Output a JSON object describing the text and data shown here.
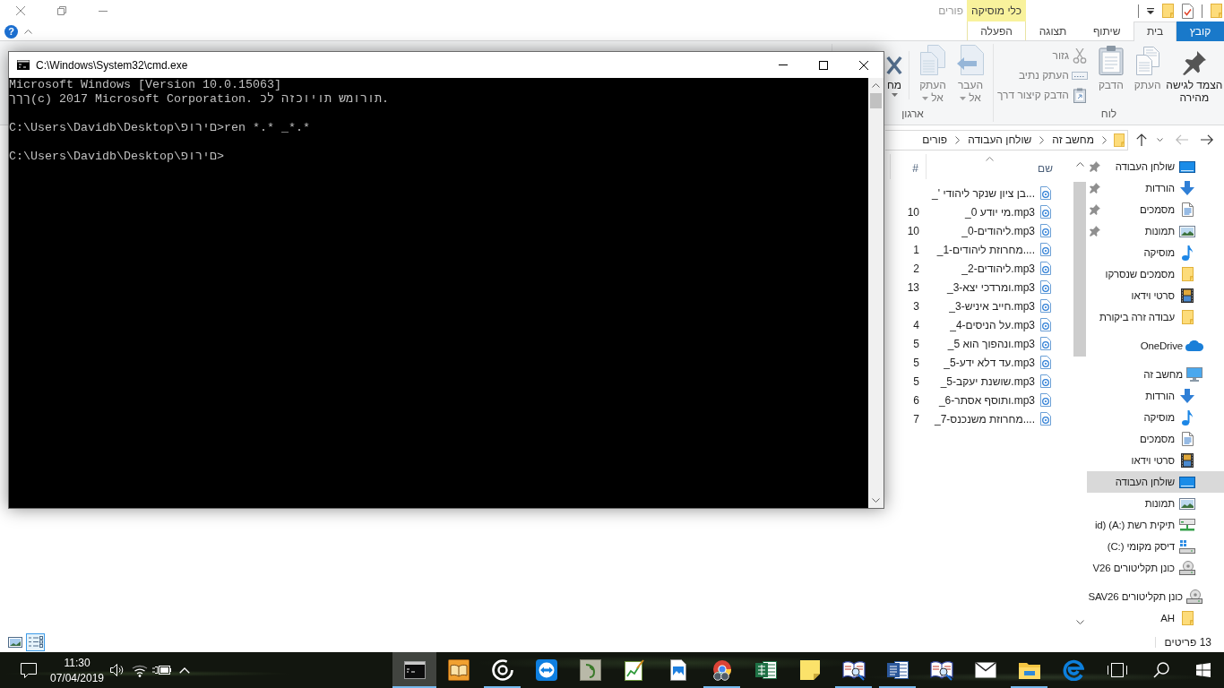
{
  "explorer": {
    "title": "פורים",
    "context_tab_group": "כלי מוסיקה",
    "help_button": "?",
    "ribbon_tabs": [
      {
        "label": "קובץ",
        "kind": "file",
        "selected": false
      },
      {
        "label": "בית",
        "kind": "tab",
        "selected": true
      },
      {
        "label": "שיתוף",
        "kind": "tab",
        "selected": false
      },
      {
        "label": "תצוגה",
        "kind": "tab",
        "selected": false
      },
      {
        "label": "הפעלה",
        "kind": "context",
        "selected": false
      }
    ],
    "ribbon_groups": [
      {
        "label": "לוח",
        "commands": [
          {
            "label": "הצמד לגישה מהירה",
            "kind": "pin",
            "disabled": false
          },
          {
            "label": "העתק",
            "kind": "copy",
            "disabled": true
          },
          {
            "label": "הדבק",
            "kind": "paste",
            "disabled": true
          },
          {
            "label": "גזור",
            "kind": "cut",
            "disabled": true
          },
          {
            "label": "העתק נתיב",
            "kind": "copypath",
            "disabled": true
          },
          {
            "label": "הדבק קיצור דרך",
            "kind": "pasteshortcut",
            "disabled": true
          }
        ]
      },
      {
        "label": "ארגון",
        "commands": [
          {
            "label": "העבר אל",
            "kind": "moveto",
            "disabled": true,
            "dropdown": true
          },
          {
            "label": "העתק אל",
            "kind": "copyto",
            "disabled": true,
            "dropdown": true
          },
          {
            "label": "מח",
            "kind": "delete",
            "disabled": false,
            "dropdown": true
          }
        ]
      }
    ],
    "address_bar": {
      "back": {
        "disabled": false
      },
      "forward": {
        "disabled": true
      },
      "path": [
        "מחשב זה",
        "שולחן העבודה",
        "פורים"
      ]
    },
    "file_list": {
      "columns": [
        {
          "label": "שם",
          "sorted": true
        },
        {
          "label": "#",
          "sorted": false
        }
      ],
      "rows": [
        {
          "name": "_' בן ציון שנקר ליהודי..."
        },
        {
          "name": "_0 מי יודע.mp3",
          "track": "10"
        },
        {
          "name": "_0-ליהודים.mp3",
          "track": "10"
        },
        {
          "name": "_1-מחרוזת ליהודים....",
          "track": "1"
        },
        {
          "name": "_2-ליהודים.mp3",
          "track": "2"
        },
        {
          "name": "_3-ומרדכי יצא.mp3",
          "track": "13"
        },
        {
          "name": "_3-חייב איניש.mp3",
          "track": "3"
        },
        {
          "name": "_4-על הניסים.mp3",
          "track": "4"
        },
        {
          "name": "_5 ונהפוך הוא.mp3",
          "track": "5"
        },
        {
          "name": "_5-עד דלא ידע.mp3",
          "track": "5"
        },
        {
          "name": "_5-שושנת יעקב.mp3",
          "track": "5"
        },
        {
          "name": "_6-ותוסף אסתר.mp3",
          "track": "6"
        },
        {
          "name": "_7-מחרוזת משנכנס....",
          "track": "7"
        }
      ]
    },
    "navigation_pane": {
      "quick_access": [
        {
          "label": "שולחן העבודה",
          "kind": "desktop",
          "pinned": true,
          "selected": false
        },
        {
          "label": "הורדות",
          "kind": "downloads",
          "pinned": true,
          "selected": false
        },
        {
          "label": "מסמכים",
          "kind": "documents",
          "pinned": true,
          "selected": false
        },
        {
          "label": "תמונות",
          "kind": "pictures",
          "pinned": true,
          "selected": false
        },
        {
          "label": "מוסיקה",
          "kind": "music",
          "pinned": false,
          "selected": false
        },
        {
          "label": "מסמכים שנסרקו",
          "kind": "folder",
          "pinned": false,
          "selected": false
        },
        {
          "label": "סרטי וידאו",
          "kind": "videos",
          "pinned": false,
          "selected": false
        },
        {
          "label": "עבודה זרה ביקורת",
          "kind": "folder",
          "pinned": false,
          "selected": false
        }
      ],
      "tree": [
        {
          "label": "OneDrive",
          "kind": "cloud",
          "selected": false
        },
        {
          "label": "מחשב זה",
          "kind": "computer",
          "selected": false,
          "children": [
            {
              "label": "הורדות",
              "kind": "downloads",
              "selected": false
            },
            {
              "label": "מוסיקה",
              "kind": "music",
              "selected": false
            },
            {
              "label": "מסמכים",
              "kind": "documents",
              "selected": false
            },
            {
              "label": "סרטי וידאו",
              "kind": "videos",
              "selected": false
            },
            {
              "label": "שולחן העבודה",
              "kind": "desktop",
              "selected": true
            },
            {
              "label": "תמונות",
              "kind": "pictures",
              "selected": false
            },
            {
              "label": "id) (A:) תיקית רשת",
              "kind": "netdrive",
              "selected": false
            },
            {
              "label": "(C:) דיסק מקומי",
              "kind": "disk",
              "selected": false
            },
            {
              "label": "V26 כונן תקליטורים",
              "kind": "cdrom",
              "selected": false
            }
          ]
        },
        {
          "label": "SAV26 כונן תקליטורים",
          "kind": "cdrom",
          "selected": false,
          "children": [
            {
              "label": "AH",
              "kind": "folder",
              "selected": false
            }
          ]
        }
      ]
    },
    "status_bar": {
      "item_count": "13 פריטים",
      "views": [
        {
          "kind": "details",
          "selected": true
        },
        {
          "kind": "thumbnails",
          "selected": false
        }
      ]
    }
  },
  "console_window": {
    "title": "C:\\Windows\\System32\\cmd.exe",
    "paragraphs": [
      [
        "Microsoft Windows [Version 10.0.15063]",
        "ךךך(c) 2017 Microsoft Corporation. כל הזכויות שמורות."
      ],
      [
        "C:\\Users\\Davidb\\Desktop\\פורים>ren *.* _*.*"
      ],
      [
        "C:\\Users\\Davidb\\Desktop\\פורים>"
      ]
    ]
  },
  "taskbar": {
    "time": "11:30",
    "date": "07/04/2019",
    "apps": [
      {
        "kind": "web",
        "running": false,
        "selected": false
      },
      {
        "kind": "files",
        "running": true,
        "selected": false
      },
      {
        "kind": "mail",
        "running": false,
        "selected": false
      },
      {
        "kind": "reader",
        "running": false,
        "selected": false
      },
      {
        "kind": "wordproc",
        "running": true,
        "selected": false
      },
      {
        "kind": "reader",
        "running": true,
        "selected": false
      },
      {
        "kind": "sticky",
        "running": false,
        "selected": false
      },
      {
        "kind": "spreadsheet",
        "running": false,
        "selected": false
      },
      {
        "kind": "browser",
        "running": true,
        "selected": false
      },
      {
        "kind": "photo",
        "running": false,
        "selected": false
      },
      {
        "kind": "notepad",
        "running": false,
        "selected": false
      },
      {
        "kind": "tile",
        "running": false,
        "selected": false
      },
      {
        "kind": "remote",
        "running": false,
        "selected": false
      },
      {
        "kind": "ring",
        "running": true,
        "selected": false
      },
      {
        "kind": "book",
        "running": false,
        "selected": false
      },
      {
        "kind": "console",
        "running": true,
        "selected": true
      }
    ]
  }
}
